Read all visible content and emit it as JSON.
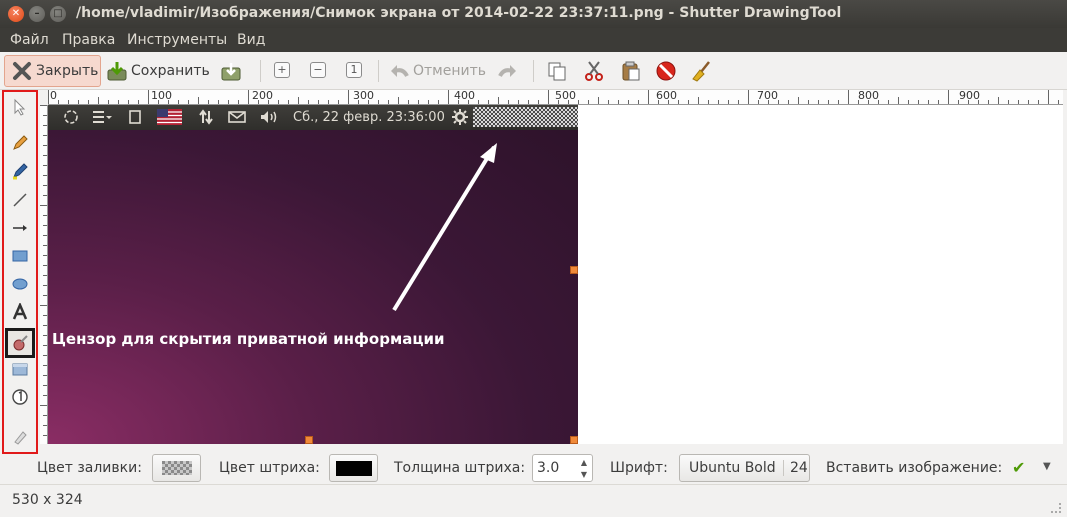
{
  "window": {
    "title": "/home/vladimir/Изображения/Снимок экрана от 2014-02-22 23:37:11.png - Shutter DrawingTool",
    "close_glyph": "✕",
    "min_glyph": "–",
    "max_glyph": "□"
  },
  "menu": [
    "Файл",
    "Правка",
    "Инструменты",
    "Вид"
  ],
  "toolbar": {
    "close_label": "Закрыть",
    "save_label": "Сохранить",
    "undo_label": "Отменить",
    "zoom_in": "+",
    "zoom_out": "−",
    "zoom_fit": "1"
  },
  "ruler": {
    "ticks": [
      "0",
      "100",
      "200",
      "300",
      "400",
      "500",
      "600",
      "700",
      "800",
      "900"
    ]
  },
  "screenshot_panel": {
    "clock": "Сб., 22 февр. 23:36:00"
  },
  "overlay_text": "Цензор для скрытия приватной информации",
  "bottom": {
    "fill_label": "Цвет заливки:",
    "stroke_label": "Цвет штриха:",
    "width_label": "Толщина штриха:",
    "width_value": "3.0",
    "font_label": "Шрифт:",
    "font_name": "Ubuntu Bold",
    "font_size": "24",
    "insert_label": "Вставить изображение:"
  },
  "status": {
    "size": "530 x 324"
  },
  "colors": {
    "highlight_border": "#e11a1a",
    "title_bg": "#3c3b37",
    "close_btn_bg": "#f6d9cf"
  },
  "icons": {
    "left_tools": [
      "select-icon",
      "pencil-icon",
      "highlighter-icon",
      "line-icon",
      "arrow-icon",
      "rectangle-icon",
      "ellipse-icon",
      "text-icon",
      "censor-icon",
      "pixelate-icon",
      "number-icon",
      "clear-icon"
    ]
  }
}
